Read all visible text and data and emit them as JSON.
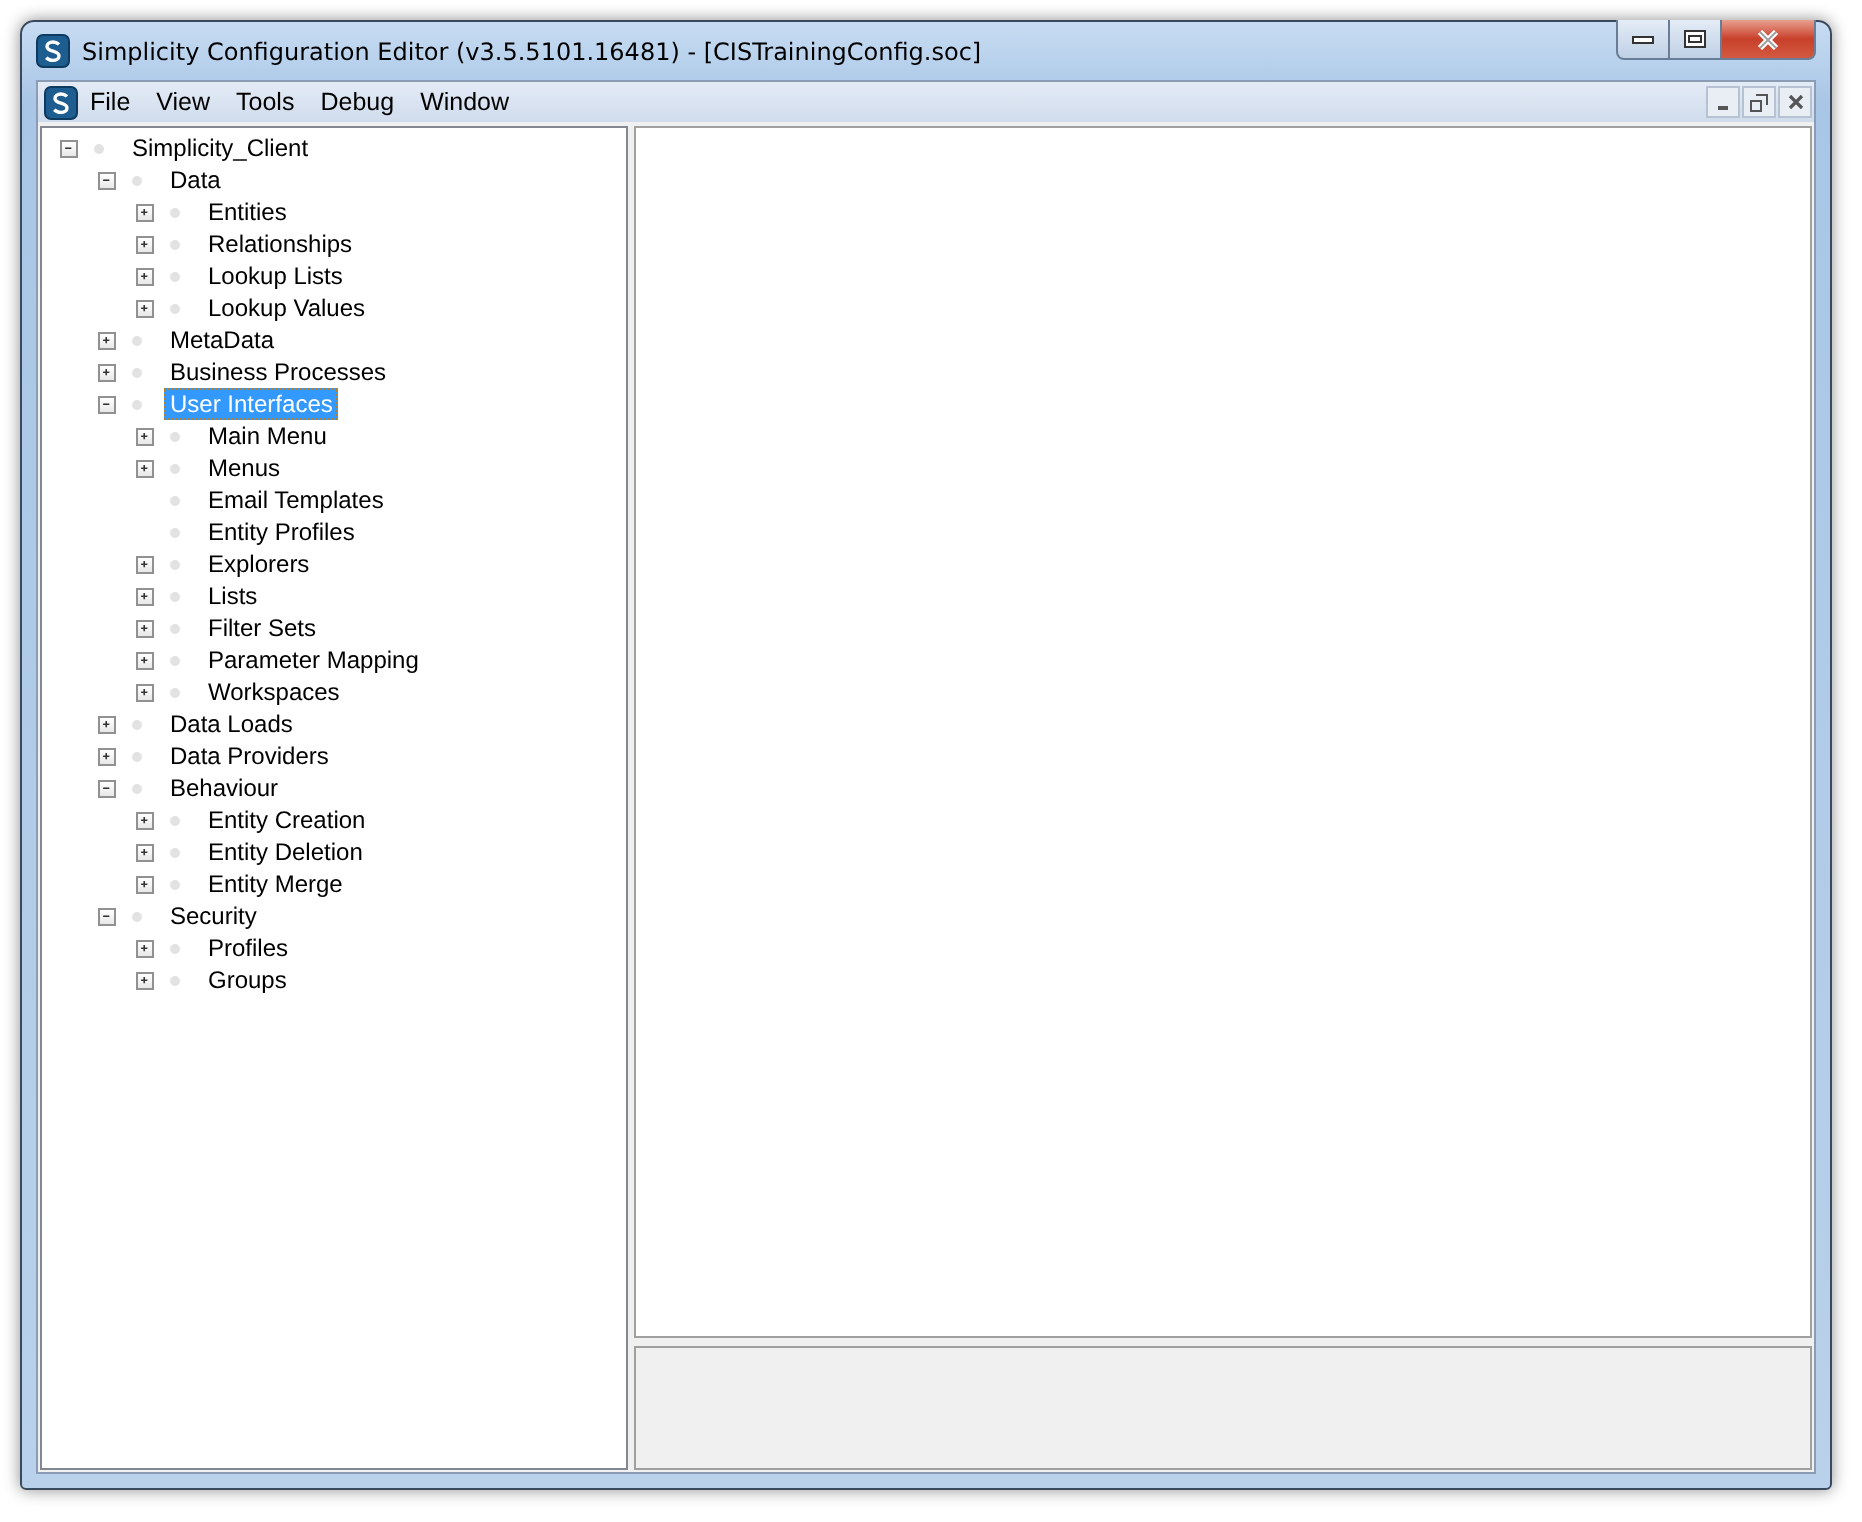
{
  "window": {
    "title": "Simplicity Configuration Editor (v3.5.5101.16481) - [CISTrainingConfig.soc]"
  },
  "menu": [
    "File",
    "View",
    "Tools",
    "Debug",
    "Window"
  ],
  "tree": [
    {
      "label": "Simplicity_Client",
      "expanded": true,
      "selected": false,
      "children": [
        {
          "label": "Data",
          "expanded": true,
          "selected": false,
          "children": [
            {
              "label": "Entities",
              "expanded": false,
              "selected": false
            },
            {
              "label": "Relationships",
              "expanded": false,
              "selected": false
            },
            {
              "label": "Lookup Lists",
              "expanded": false,
              "selected": false
            },
            {
              "label": "Lookup Values",
              "expanded": false,
              "selected": false
            }
          ]
        },
        {
          "label": "MetaData",
          "expanded": false,
          "selected": false
        },
        {
          "label": "Business Processes",
          "expanded": false,
          "selected": false
        },
        {
          "label": "User Interfaces",
          "expanded": true,
          "selected": true,
          "children": [
            {
              "label": "Main Menu",
              "expanded": false,
              "selected": false
            },
            {
              "label": "Menus",
              "expanded": false,
              "selected": false
            },
            {
              "label": "Email Templates",
              "selected": false
            },
            {
              "label": "Entity Profiles",
              "selected": false
            },
            {
              "label": "Explorers",
              "expanded": false,
              "selected": false
            },
            {
              "label": "Lists",
              "expanded": false,
              "selected": false
            },
            {
              "label": "Filter Sets",
              "expanded": false,
              "selected": false
            },
            {
              "label": "Parameter Mapping",
              "expanded": false,
              "selected": false
            },
            {
              "label": "Workspaces",
              "expanded": false,
              "selected": false
            }
          ]
        },
        {
          "label": "Data Loads",
          "expanded": false,
          "selected": false
        },
        {
          "label": "Data Providers",
          "expanded": false,
          "selected": false
        },
        {
          "label": "Behaviour",
          "expanded": true,
          "selected": false,
          "children": [
            {
              "label": "Entity Creation",
              "expanded": false,
              "selected": false
            },
            {
              "label": "Entity Deletion",
              "expanded": false,
              "selected": false
            },
            {
              "label": "Entity Merge",
              "expanded": false,
              "selected": false
            }
          ]
        },
        {
          "label": "Security",
          "expanded": true,
          "selected": false,
          "children": [
            {
              "label": "Profiles",
              "expanded": false,
              "selected": false
            },
            {
              "label": "Groups",
              "expanded": false,
              "selected": false
            }
          ]
        }
      ]
    }
  ]
}
